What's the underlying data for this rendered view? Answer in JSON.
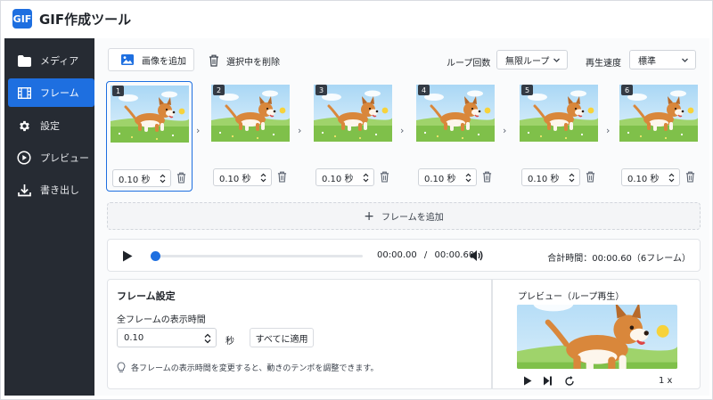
{
  "app": {
    "logo_text": "GIF",
    "title": "GIF作成ツール",
    "accent": "#1e6fe0",
    "sidebar_bg": "#262b33"
  },
  "sidebar": {
    "items": [
      {
        "label": "メディア",
        "icon": "folder-icon"
      },
      {
        "label": "フレーム",
        "icon": "film-icon",
        "active": true
      },
      {
        "label": "設定",
        "icon": "gear-icon"
      },
      {
        "label": "プレビュー",
        "icon": "play-circle-icon"
      },
      {
        "label": "書き出し",
        "icon": "download-icon"
      }
    ]
  },
  "toolbar": {
    "add_image": "画像を追加",
    "delete_selected": "選択中を削除",
    "loop_label": "ループ回数",
    "loop_value": "無限ループ",
    "speed_label": "再生速度",
    "speed_value": "標準"
  },
  "frames": [
    {
      "num": "1",
      "duration": "0.10 秒",
      "selected": true
    },
    {
      "num": "2",
      "duration": "0.10 秒"
    },
    {
      "num": "3",
      "duration": "0.10 秒"
    },
    {
      "num": "4",
      "duration": "0.10 秒"
    },
    {
      "num": "5",
      "duration": "0.10 秒"
    },
    {
      "num": "6",
      "duration": "0.10 秒"
    }
  ],
  "add_frame": {
    "icon": "+",
    "label": "フレームを追加"
  },
  "player": {
    "current": "00:00.00",
    "separator": "/",
    "duration": "00:00.60",
    "progress": 0,
    "total_label": "合計時間：00:00.60（6フレーム）"
  },
  "frame_settings": {
    "title": "フレーム設定",
    "all_duration_label": "全フレームの表示時間",
    "value": "0.10",
    "unit": "秒",
    "apply": "すべてに適用",
    "hint": "各フレームの表示時間を変更すると、動きのテンポを調整できます。"
  },
  "preview": {
    "title": "プレビュー（ループ再生）",
    "speed": "1 x"
  }
}
